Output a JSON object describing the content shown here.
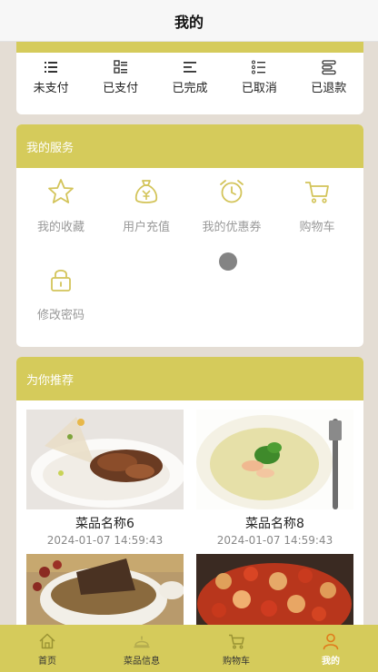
{
  "header": {
    "title": "我的"
  },
  "orders": {
    "items": [
      {
        "label": "未支付",
        "icon": "list-icon"
      },
      {
        "label": "已支付",
        "icon": "grid-list-icon"
      },
      {
        "label": "已完成",
        "icon": "align-left-icon"
      },
      {
        "label": "已取消",
        "icon": "checklist-icon"
      },
      {
        "label": "已退款",
        "icon": "stack-icon"
      }
    ]
  },
  "services": {
    "title": "我的服务",
    "items": [
      {
        "label": "我的收藏",
        "icon": "star-icon"
      },
      {
        "label": "用户充值",
        "icon": "money-bag-icon"
      },
      {
        "label": "我的优惠券",
        "icon": "alarm-clock-icon"
      },
      {
        "label": "购物车",
        "icon": "cart-icon"
      },
      {
        "label": "修改密码",
        "icon": "lock-icon"
      }
    ]
  },
  "recommend": {
    "title": "为你推荐",
    "items": [
      {
        "name": "菜品名称6",
        "time": "2024-01-07 14:59:43"
      },
      {
        "name": "菜品名称8",
        "time": "2024-01-07 14:59:43"
      },
      {
        "name": "",
        "time": ""
      },
      {
        "name": "",
        "time": ""
      }
    ]
  },
  "tabbar": {
    "items": [
      {
        "label": "首页",
        "icon": "home-icon"
      },
      {
        "label": "菜品信息",
        "icon": "dish-info-icon"
      },
      {
        "label": "购物车",
        "icon": "cart-icon"
      },
      {
        "label": "我的",
        "icon": "user-icon",
        "active": true
      }
    ]
  },
  "colors": {
    "accent": "#d5cb5b",
    "background": "#e4ddd4",
    "icon_gold": "#d3c45a"
  }
}
